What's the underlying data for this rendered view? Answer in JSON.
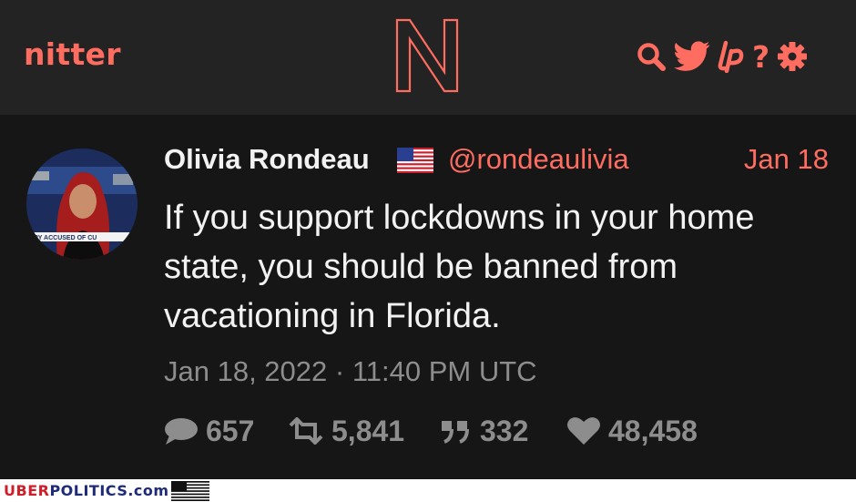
{
  "nav": {
    "brand": "nitter",
    "logo_letter": "N",
    "icons": [
      "search-icon",
      "twitter-bird-icon",
      "liberapay-icon",
      "help-icon",
      "gear-icon"
    ],
    "help_glyph": "?"
  },
  "tweet": {
    "fullname": "Olivia Rondeau",
    "flag": "us-flag-emoji",
    "username": "@rondeaulivia",
    "date_short": "Jan 18",
    "text": "If you support lockdowns in your home state, you should be banned from vacationing in Florida.",
    "published": "Jan 18, 2022 · 11:40 PM UTC",
    "avatar_caption": "RY ACCUSED OF CU",
    "stats": {
      "replies": "657",
      "retweets": "5,841",
      "quotes": "332",
      "likes": "48,458"
    }
  },
  "watermark": {
    "uber": "UBER",
    "politics": "POLITICS",
    "dotcom": ".com"
  },
  "colors": {
    "accent": "#ff6c60",
    "background": "#161616",
    "navbar": "#232323",
    "text": "#f2f2f2",
    "muted": "#8d8d8d"
  }
}
